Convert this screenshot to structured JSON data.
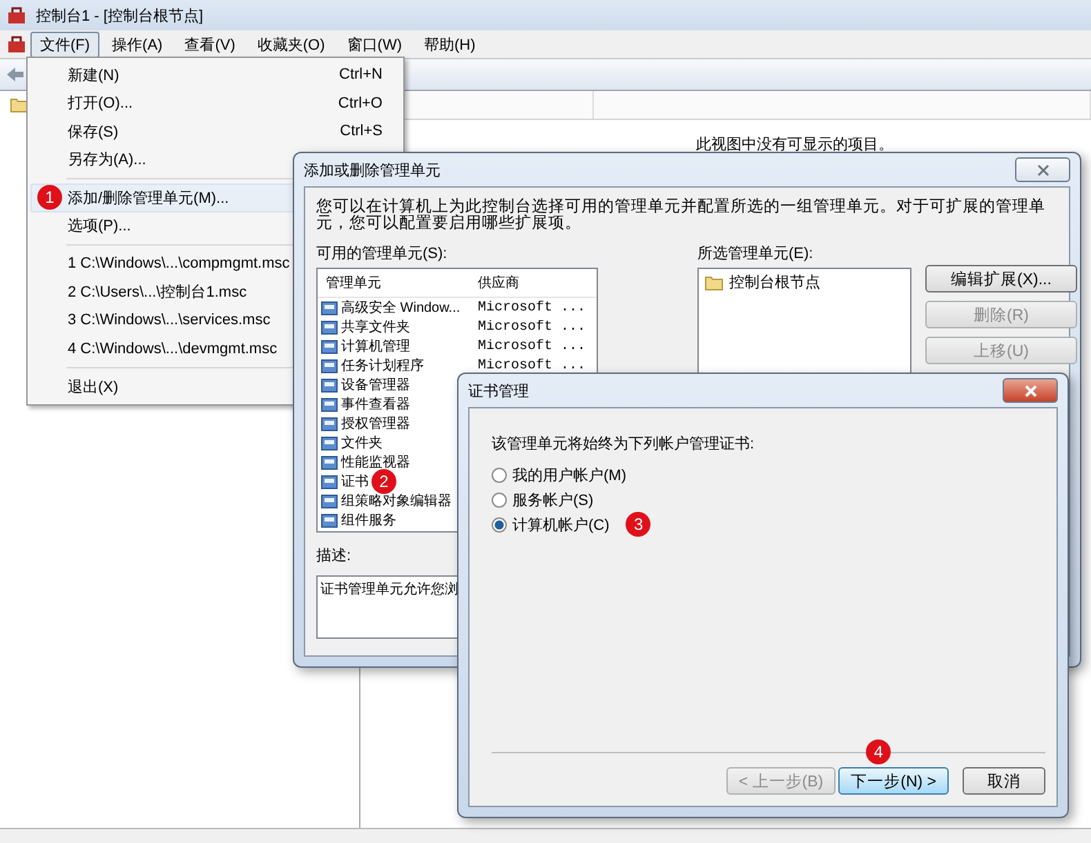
{
  "window": {
    "title": "控制台1 - [控制台根节点]"
  },
  "menubar": [
    {
      "label": "文件(F)",
      "selected": true
    },
    {
      "label": "操作(A)",
      "selected": false
    },
    {
      "label": "查看(V)",
      "selected": false
    },
    {
      "label": "收藏夹(O)",
      "selected": false
    },
    {
      "label": "窗口(W)",
      "selected": false
    },
    {
      "label": "帮助(H)",
      "selected": false
    }
  ],
  "result_pane": {
    "empty_text": "此视图中没有可显示的项目。"
  },
  "file_menu": [
    {
      "kind": "item",
      "label": "新建(N)",
      "shortcut": "Ctrl+N",
      "selected": false
    },
    {
      "kind": "item",
      "label": "打开(O)...",
      "shortcut": "Ctrl+O",
      "selected": false
    },
    {
      "kind": "item",
      "label": "保存(S)",
      "shortcut": "Ctrl+S",
      "selected": false
    },
    {
      "kind": "item",
      "label": "另存为(A)...",
      "selected": false
    },
    {
      "kind": "separator"
    },
    {
      "kind": "item",
      "label": "添加/删除管理单元(M)...",
      "selected": true,
      "step": "1"
    },
    {
      "kind": "item",
      "label": "选项(P)...",
      "selected": false
    },
    {
      "kind": "separator"
    },
    {
      "kind": "item",
      "label": "1 C:\\Windows\\...\\compmgmt.msc",
      "selected": false
    },
    {
      "kind": "item",
      "label": "2 C:\\Users\\...\\控制台1.msc",
      "selected": false
    },
    {
      "kind": "item",
      "label": "3 C:\\Windows\\...\\services.msc",
      "selected": false
    },
    {
      "kind": "item",
      "label": "4 C:\\Windows\\...\\devmgmt.msc",
      "selected": false
    },
    {
      "kind": "separator"
    },
    {
      "kind": "item",
      "label": "退出(X)",
      "selected": false
    }
  ],
  "add_remove_dialog": {
    "title": "添加或删除管理单元",
    "intro": "您可以在计算机上为此控制台选择可用的管理单元并配置所选的一组管理单元。对于可扩展的管理单元，您可以配置要启用哪些扩展项。",
    "available_label": "可用的管理单元(S):",
    "columns": [
      "管理单元",
      "供应商"
    ],
    "snapins": [
      {
        "name": "高级安全 Window...",
        "provider": "Microsoft ..."
      },
      {
        "name": "共享文件夹",
        "provider": "Microsoft ..."
      },
      {
        "name": "计算机管理",
        "provider": "Microsoft ..."
      },
      {
        "name": "任务计划程序",
        "provider": "Microsoft ..."
      },
      {
        "name": "设备管理器"
      },
      {
        "name": "事件查看器"
      },
      {
        "name": "授权管理器"
      },
      {
        "name": "文件夹"
      },
      {
        "name": "性能监视器"
      },
      {
        "name": "证书",
        "step": "2"
      },
      {
        "name": "组策略对象编辑器"
      },
      {
        "name": "组件服务"
      }
    ],
    "selected_label": "所选管理单元(E):",
    "selected_items": [
      "控制台根节点"
    ],
    "buttons": [
      {
        "label": "编辑扩展(X)...",
        "disabled": false
      },
      {
        "label": "删除(R)",
        "disabled": true
      },
      {
        "label": "上移(U)",
        "disabled": true
      }
    ],
    "description_label": "描述:",
    "description": "证书管理单元允许您浏"
  },
  "cert_dialog": {
    "title": "证书管理",
    "prompt": "该管理单元将始终为下列帐户管理证书:",
    "options": [
      {
        "label": "我的用户帐户(M)",
        "selected": false
      },
      {
        "label": "服务帐户(S)",
        "selected": false
      },
      {
        "label": "计算机帐户(C)",
        "selected": true,
        "step": "3"
      }
    ],
    "buttons": [
      {
        "label": "< 上一步(B)",
        "disabled": true,
        "default": false
      },
      {
        "label": "下一步(N) >",
        "disabled": false,
        "default": true,
        "step": "4"
      },
      {
        "label": "取消",
        "disabled": false,
        "default": false
      }
    ]
  }
}
